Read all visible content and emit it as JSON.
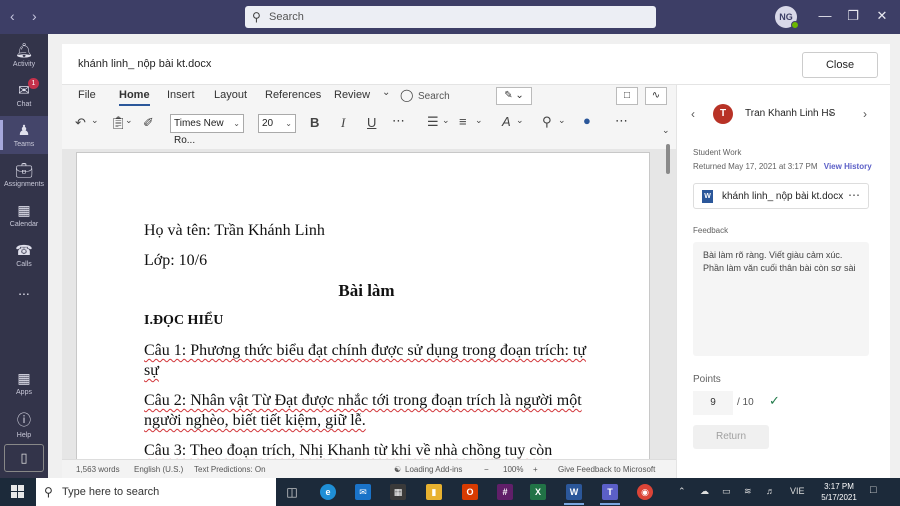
{
  "titlebar": {
    "search_placeholder": "Search",
    "user_initials": "NG"
  },
  "rail": {
    "items": [
      {
        "label": "Activity",
        "icon": "bell-icon"
      },
      {
        "label": "Chat",
        "icon": "chat-icon",
        "badge": "1"
      },
      {
        "label": "Teams",
        "icon": "teams-icon"
      },
      {
        "label": "Assignments",
        "icon": "assignments-icon"
      },
      {
        "label": "Calendar",
        "icon": "calendar-icon"
      },
      {
        "label": "Calls",
        "icon": "phone-icon"
      },
      {
        "label": "...",
        "icon": "more-icon"
      },
      {
        "label": "Apps",
        "icon": "apps-icon"
      },
      {
        "label": "Help",
        "icon": "help-icon"
      }
    ]
  },
  "document": {
    "filename": "khánh linh_ nộp bài kt.docx",
    "close_label": "Close"
  },
  "ribbon": {
    "tabs": [
      "File",
      "Home",
      "Insert",
      "Layout",
      "References",
      "Review"
    ],
    "active_tab": "Home",
    "search_label": "Search",
    "font_name": "Times New Ro...",
    "font_size": "20"
  },
  "page": {
    "line1": "Họ và tên: Trần Khánh Linh",
    "line2": "Lớp: 10/6",
    "title": "Bài làm",
    "section": "I.ĐỌC HIỂU",
    "q1": "Câu 1: Phương thức biểu đạt chính được sử dụng trong đoạn trích: tự sự",
    "q2": "Câu 2: Nhân vật Từ Đạt được nhắc tới trong đoạn trích là người một người nghèo, biết tiết kiệm, giữ lễ.",
    "q3": "Câu 3: Theo đoạn trích, Nhị Khanh từ khi về nhà chồng tuy còn"
  },
  "status": {
    "words": "1,563 words",
    "language": "English (U.S.)",
    "predictions": "Text Predictions: On",
    "addins": "Loading Add-ins",
    "zoom": "100%",
    "feedback": "Give Feedback to Microsoft"
  },
  "panel": {
    "student_initial": "T",
    "student_name": "Tran Khanh Linh HS",
    "student_work_label": "Student Work",
    "returned": "Returned May 17, 2021 at 3:17 PM",
    "view_history": "View History",
    "file_name": "khánh linh_ nộp bài kt.docx",
    "feedback_label": "Feedback",
    "feedback_text": "Bài làm rõ ràng. Viết giàu cảm xúc. Phần làm văn cuối thân bài còn sơ sài",
    "points_label": "Points",
    "points_value": "9",
    "points_max": "/ 10",
    "return_label": "Return"
  },
  "taskbar": {
    "search_placeholder": "Type here to search",
    "language": "VIE",
    "time": "3:17 PM",
    "date": "5/17/2021"
  }
}
